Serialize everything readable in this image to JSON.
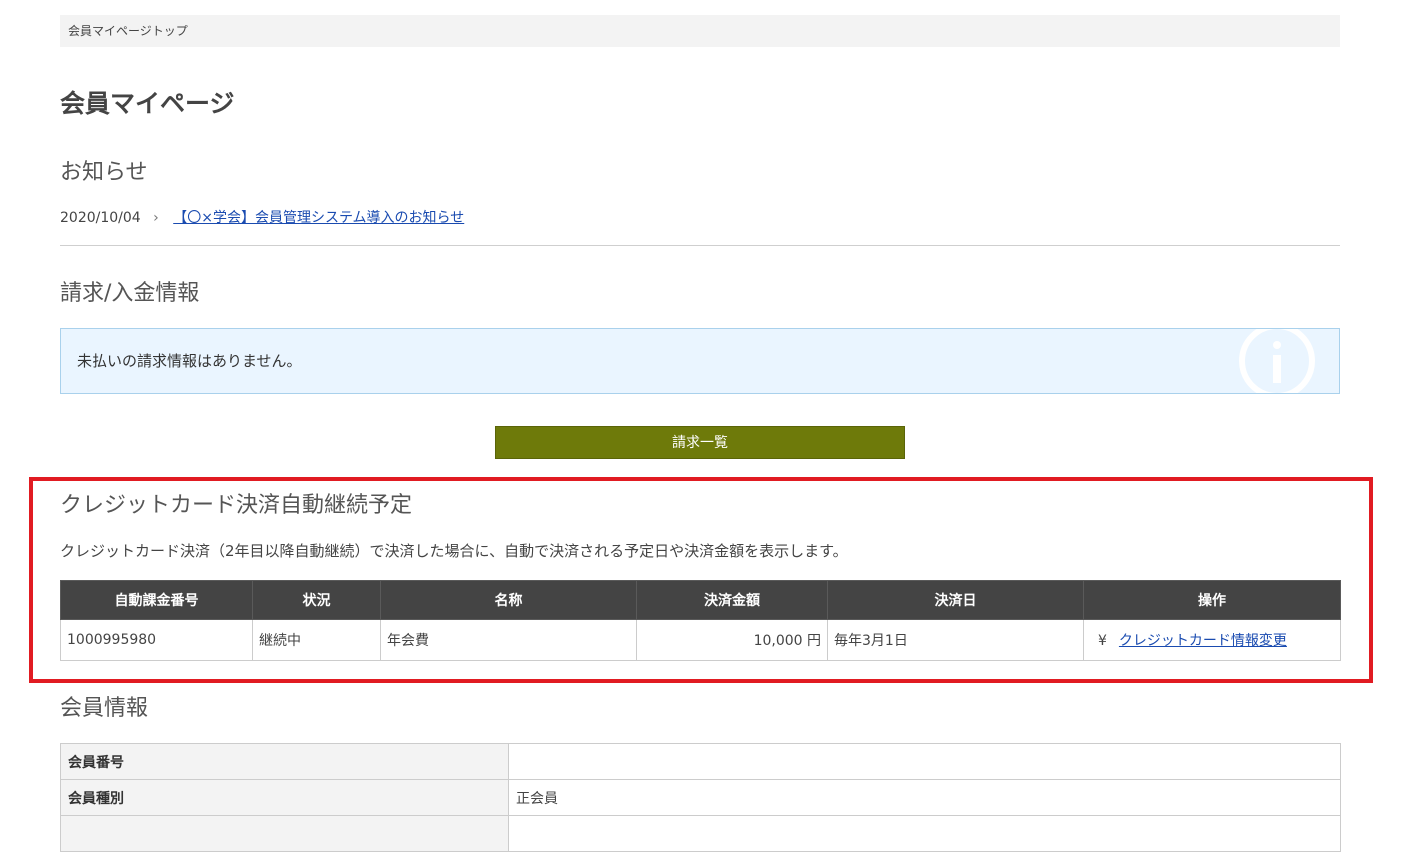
{
  "breadcrumb": {
    "top": "会員マイページトップ"
  },
  "page": {
    "title": "会員マイページ"
  },
  "news": {
    "heading": "お知らせ",
    "items": [
      {
        "date": "2020/10/04",
        "arrow": "›",
        "title": "【〇×学会】会員管理システム導入のお知らせ"
      }
    ]
  },
  "billing": {
    "heading": "請求/入金情報",
    "info_message": "未払いの請求情報はありません。",
    "list_button": "請求一覧"
  },
  "credit_card": {
    "heading": "クレジットカード決済自動継続予定",
    "description": "クレジットカード決済（2年目以降自動継続）で決済した場合に、自動で決済される予定日や決済金額を表示します。",
    "columns": [
      "自動課金番号",
      "状況",
      "名称",
      "決済金額",
      "決済日",
      "操作"
    ],
    "rows": [
      {
        "number": "1000995980",
        "status": "継続中",
        "name": "年会費",
        "amount": "10,000 円",
        "date": "毎年3月1日",
        "action_icon": "¥",
        "action": "クレジットカード情報変更"
      }
    ]
  },
  "member": {
    "heading": "会員情報",
    "rows": [
      {
        "label": "会員番号",
        "value": ""
      },
      {
        "label": "会員種別",
        "value": "正会員"
      }
    ]
  },
  "colors": {
    "button": "#6e7a0a",
    "highlight": "#e11b22",
    "info_bg": "#eaf5ff",
    "table_header": "#444444",
    "link": "#1a4bb0"
  }
}
